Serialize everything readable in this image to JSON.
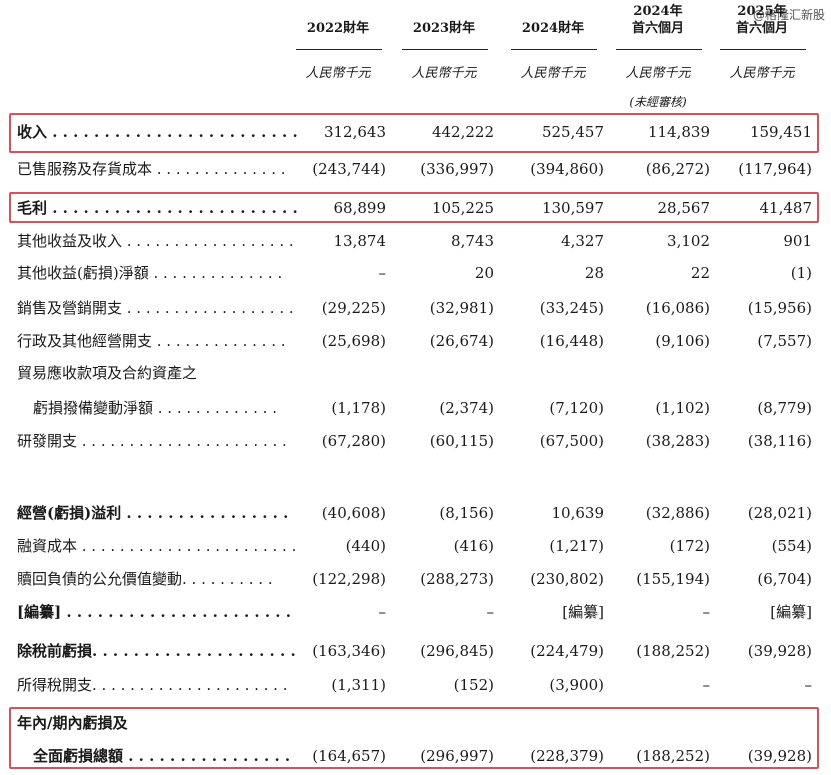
{
  "watermark": "@格隆汇新股",
  "columns": [
    {
      "line1": "",
      "line2": "2022財年",
      "unit": "人民幣千元",
      "note": ""
    },
    {
      "line1": "",
      "line2": "2023財年",
      "unit": "人民幣千元",
      "note": ""
    },
    {
      "line1": "",
      "line2": "2024財年",
      "unit": "人民幣千元",
      "note": ""
    },
    {
      "line1": "2024年",
      "line2": "首六個月",
      "unit": "人民幣千元",
      "note": "(未經審核)"
    },
    {
      "line1": "2025年",
      "line2": "首六個月",
      "unit": "人民幣千元",
      "note": ""
    }
  ],
  "rows": [
    {
      "label": "收入 . . . . . . . . . . . . . . . . . . . . . . . . . . .",
      "values": [
        "312,643",
        "442,222",
        "525,457",
        "114,839",
        "159,451"
      ]
    },
    {
      "label": "已售服務及存貨成本 . . . . . . . . . . . . . .",
      "values": [
        "(243,744)",
        "(336,997)",
        "(394,860)",
        "(86,272)",
        "(117,964)"
      ]
    },
    {
      "label": "毛利 . . . . . . . . . . . . . . . . . . . . . . . . . . .",
      "values": [
        "68,899",
        "105,225",
        "130,597",
        "28,567",
        "41,487"
      ]
    },
    {
      "label": "其他收益及收入 . . . . . . . . . . . . . . . . . .",
      "values": [
        "13,874",
        "8,743",
        "4,327",
        "3,102",
        "901"
      ]
    },
    {
      "label": "其他收益(虧損)淨額 . . . . . . . . . . . . . .",
      "values": [
        "–",
        "20",
        "28",
        "22",
        "(1)"
      ]
    },
    {
      "label": "銷售及營銷開支 . . . . . . . . . . . . . . . . . .",
      "values": [
        "(29,225)",
        "(32,981)",
        "(33,245)",
        "(16,086)",
        "(15,956)"
      ]
    },
    {
      "label": "行政及其他經營開支 . . . . . . . . . . . . . .",
      "values": [
        "(25,698)",
        "(26,674)",
        "(16,448)",
        "(9,106)",
        "(7,557)"
      ]
    },
    {
      "label": "貿易應收款項及合約資產之",
      "values": [
        "",
        "",
        "",
        "",
        ""
      ]
    },
    {
      "label": "虧損撥備變動淨額 . . . . . . . . . . . . .",
      "values": [
        "(1,178)",
        "(2,374)",
        "(7,120)",
        "(1,102)",
        "(8,779)"
      ]
    },
    {
      "label": "研發開支 . . . . . . . . . . . . . . . . . . . . . .",
      "values": [
        "(67,280)",
        "(60,115)",
        "(67,500)",
        "(38,283)",
        "(38,116)"
      ]
    },
    {
      "label": "經營(虧損)溢利 . . . . . . . . . . . . . . . .",
      "values": [
        "(40,608)",
        "(8,156)",
        "10,639",
        "(32,886)",
        "(28,021)"
      ]
    },
    {
      "label": "融資成本 . . . . . . . . . . . . . . . . . . . . . . .",
      "values": [
        "(440)",
        "(416)",
        "(1,217)",
        "(172)",
        "(554)"
      ]
    },
    {
      "label": "贖回負債的公允價值變動. . . . . . . . . .",
      "values": [
        "(122,298)",
        "(288,273)",
        "(230,802)",
        "(155,194)",
        "(6,704)"
      ]
    },
    {
      "label": "[編纂] . . . . . . . . . . . . . . . . . . . . . . . .",
      "values": [
        "–",
        "–",
        "[編纂]",
        "–",
        "[編纂]"
      ]
    },
    {
      "label": "除稅前虧損. . . . . . . . . . . . . . . . . . . . .",
      "values": [
        "(163,346)",
        "(296,845)",
        "(224,479)",
        "(188,252)",
        "(39,928)"
      ]
    },
    {
      "label": "所得稅開支. . . . . . . . . . . . . . . . . . . . .",
      "values": [
        "(1,311)",
        "(152)",
        "(3,900)",
        "–",
        "–"
      ]
    },
    {
      "label": "年內/期內虧損及",
      "values": [
        "",
        "",
        "",
        "",
        ""
      ]
    },
    {
      "label": "全面虧損總額 . . . . . . . . . . . . . . . .",
      "values": [
        "(164,657)",
        "(296,997)",
        "(228,379)",
        "(188,252)",
        "(39,928)"
      ]
    }
  ],
  "highlight_color": "#d8505a"
}
